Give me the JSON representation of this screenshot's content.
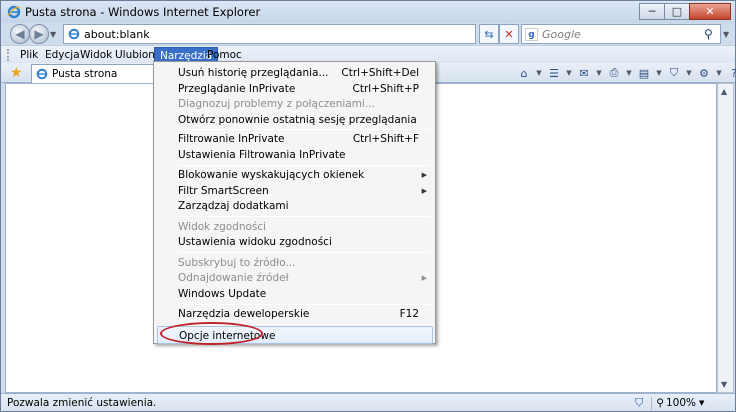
{
  "window": {
    "title": "Pusta strona - Windows Internet Explorer",
    "minimize": "─",
    "maximize": "□",
    "close": "✕"
  },
  "address_bar": {
    "url": "about:blank",
    "refresh_icon": "refresh-icon",
    "stop_icon": "stop-icon"
  },
  "search": {
    "placeholder": "Google",
    "provider_icon": "google-icon"
  },
  "menubar": {
    "items": [
      "Plik",
      "Edycja",
      "Widok",
      "Ulubione",
      "Narzędzia",
      "Pomoc"
    ],
    "active": "Narzędzia"
  },
  "tab": {
    "title": "Pusta strona"
  },
  "tools_menu": {
    "items": [
      {
        "label": "Usuń historię przeglądania...",
        "shortcut": "Ctrl+Shift+Del",
        "enabled": true
      },
      {
        "label": "Przeglądanie InPrivate",
        "shortcut": "Ctrl+Shift+P",
        "enabled": true
      },
      {
        "label": "Diagnozuj problemy z połączeniami...",
        "shortcut": "",
        "enabled": false
      },
      {
        "label": "Otwórz ponownie ostatnią sesję przeglądania",
        "shortcut": "",
        "enabled": true
      },
      {
        "label": "Filtrowanie InPrivate",
        "shortcut": "Ctrl+Shift+F",
        "enabled": true
      },
      {
        "label": "Ustawienia Filtrowania InPrivate",
        "shortcut": "",
        "enabled": true
      },
      {
        "label": "Blokowanie wyskakujących okienek",
        "shortcut": "",
        "enabled": true,
        "submenu": true
      },
      {
        "label": "Filtr SmartScreen",
        "shortcut": "",
        "enabled": true,
        "submenu": true
      },
      {
        "label": "Zarządzaj dodatkami",
        "shortcut": "",
        "enabled": true
      },
      {
        "label": "Widok zgodności",
        "shortcut": "",
        "enabled": false
      },
      {
        "label": "Ustawienia widoku zgodności",
        "shortcut": "",
        "enabled": true
      },
      {
        "label": "Subskrybuj to źródło...",
        "shortcut": "",
        "enabled": false
      },
      {
        "label": "Odnajdowanie źródeł",
        "shortcut": "",
        "enabled": false,
        "submenu": true
      },
      {
        "label": "Windows Update",
        "shortcut": "",
        "enabled": true
      },
      {
        "label": "Narzędzia deweloperskie",
        "shortcut": "F12",
        "enabled": true
      },
      {
        "label": "Opcje internetowe",
        "shortcut": "",
        "enabled": true,
        "highlighted": true
      }
    ]
  },
  "status_bar": {
    "text": "Pozwala zmienić ustawienia.",
    "zoom": "100%"
  },
  "colors": {
    "menu_active": "#3a6fc7",
    "highlight_ellipse": "#c0222a"
  }
}
